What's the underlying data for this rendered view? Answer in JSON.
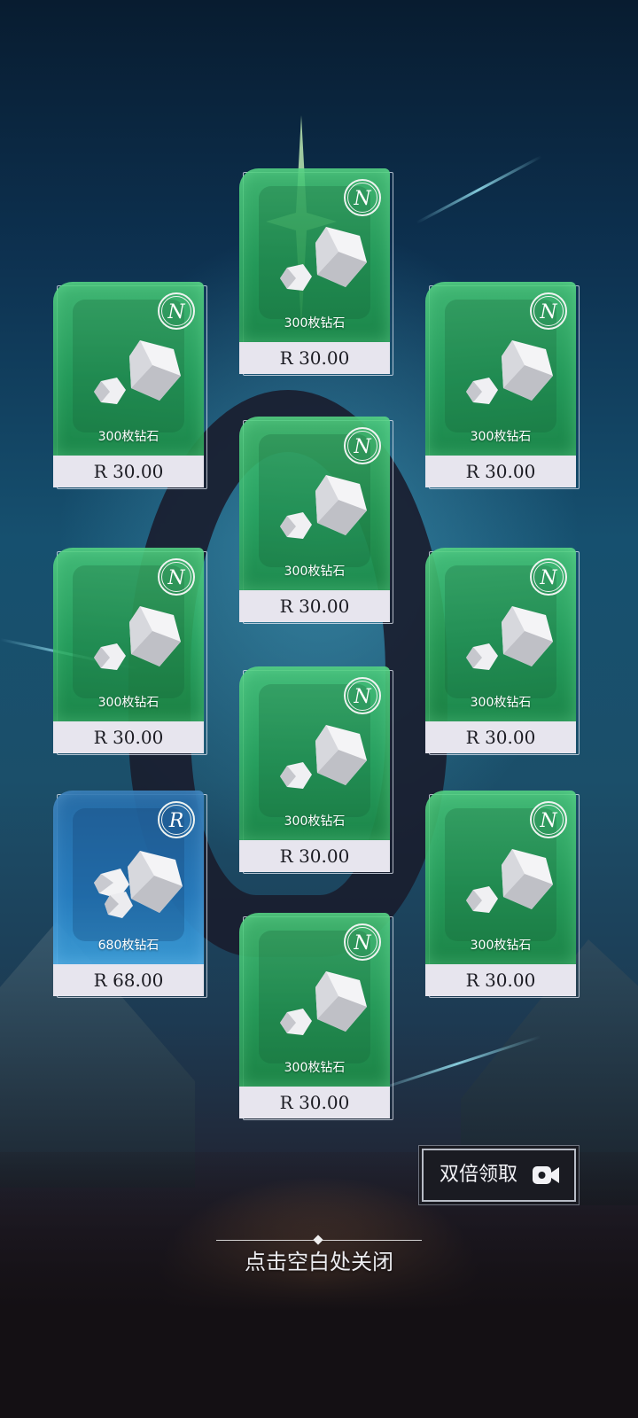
{
  "rewards": [
    {
      "id": "c1",
      "rarity": "N",
      "quantity": "300枚钻石",
      "price": "R 30.00"
    },
    {
      "id": "c2",
      "rarity": "N",
      "quantity": "300枚钻石",
      "price": "R 30.00"
    },
    {
      "id": "c3",
      "rarity": "N",
      "quantity": "300枚钻石",
      "price": "R 30.00"
    },
    {
      "id": "c4",
      "rarity": "N",
      "quantity": "300枚钻石",
      "price": "R 30.00"
    },
    {
      "id": "c5",
      "rarity": "N",
      "quantity": "300枚钻石",
      "price": "R 30.00"
    },
    {
      "id": "c6",
      "rarity": "N",
      "quantity": "300枚钻石",
      "price": "R 30.00"
    },
    {
      "id": "c7",
      "rarity": "N",
      "quantity": "300枚钻石",
      "price": "R 30.00"
    },
    {
      "id": "c8",
      "rarity": "R",
      "quantity": "680枚钻石",
      "price": "R 68.00"
    },
    {
      "id": "c9",
      "rarity": "N",
      "quantity": "300枚钻石",
      "price": "R 30.00"
    },
    {
      "id": "c10",
      "rarity": "N",
      "quantity": "300枚钻石",
      "price": "R 30.00"
    }
  ],
  "actions": {
    "double_claim_label": "双倍领取",
    "double_claim_icon": "video-camera-icon",
    "close_hint": "点击空白处关闭"
  },
  "colors": {
    "common_card": "#33b36a",
    "rare_card": "#2a82c4",
    "price_strip": "#e7e5ee"
  }
}
